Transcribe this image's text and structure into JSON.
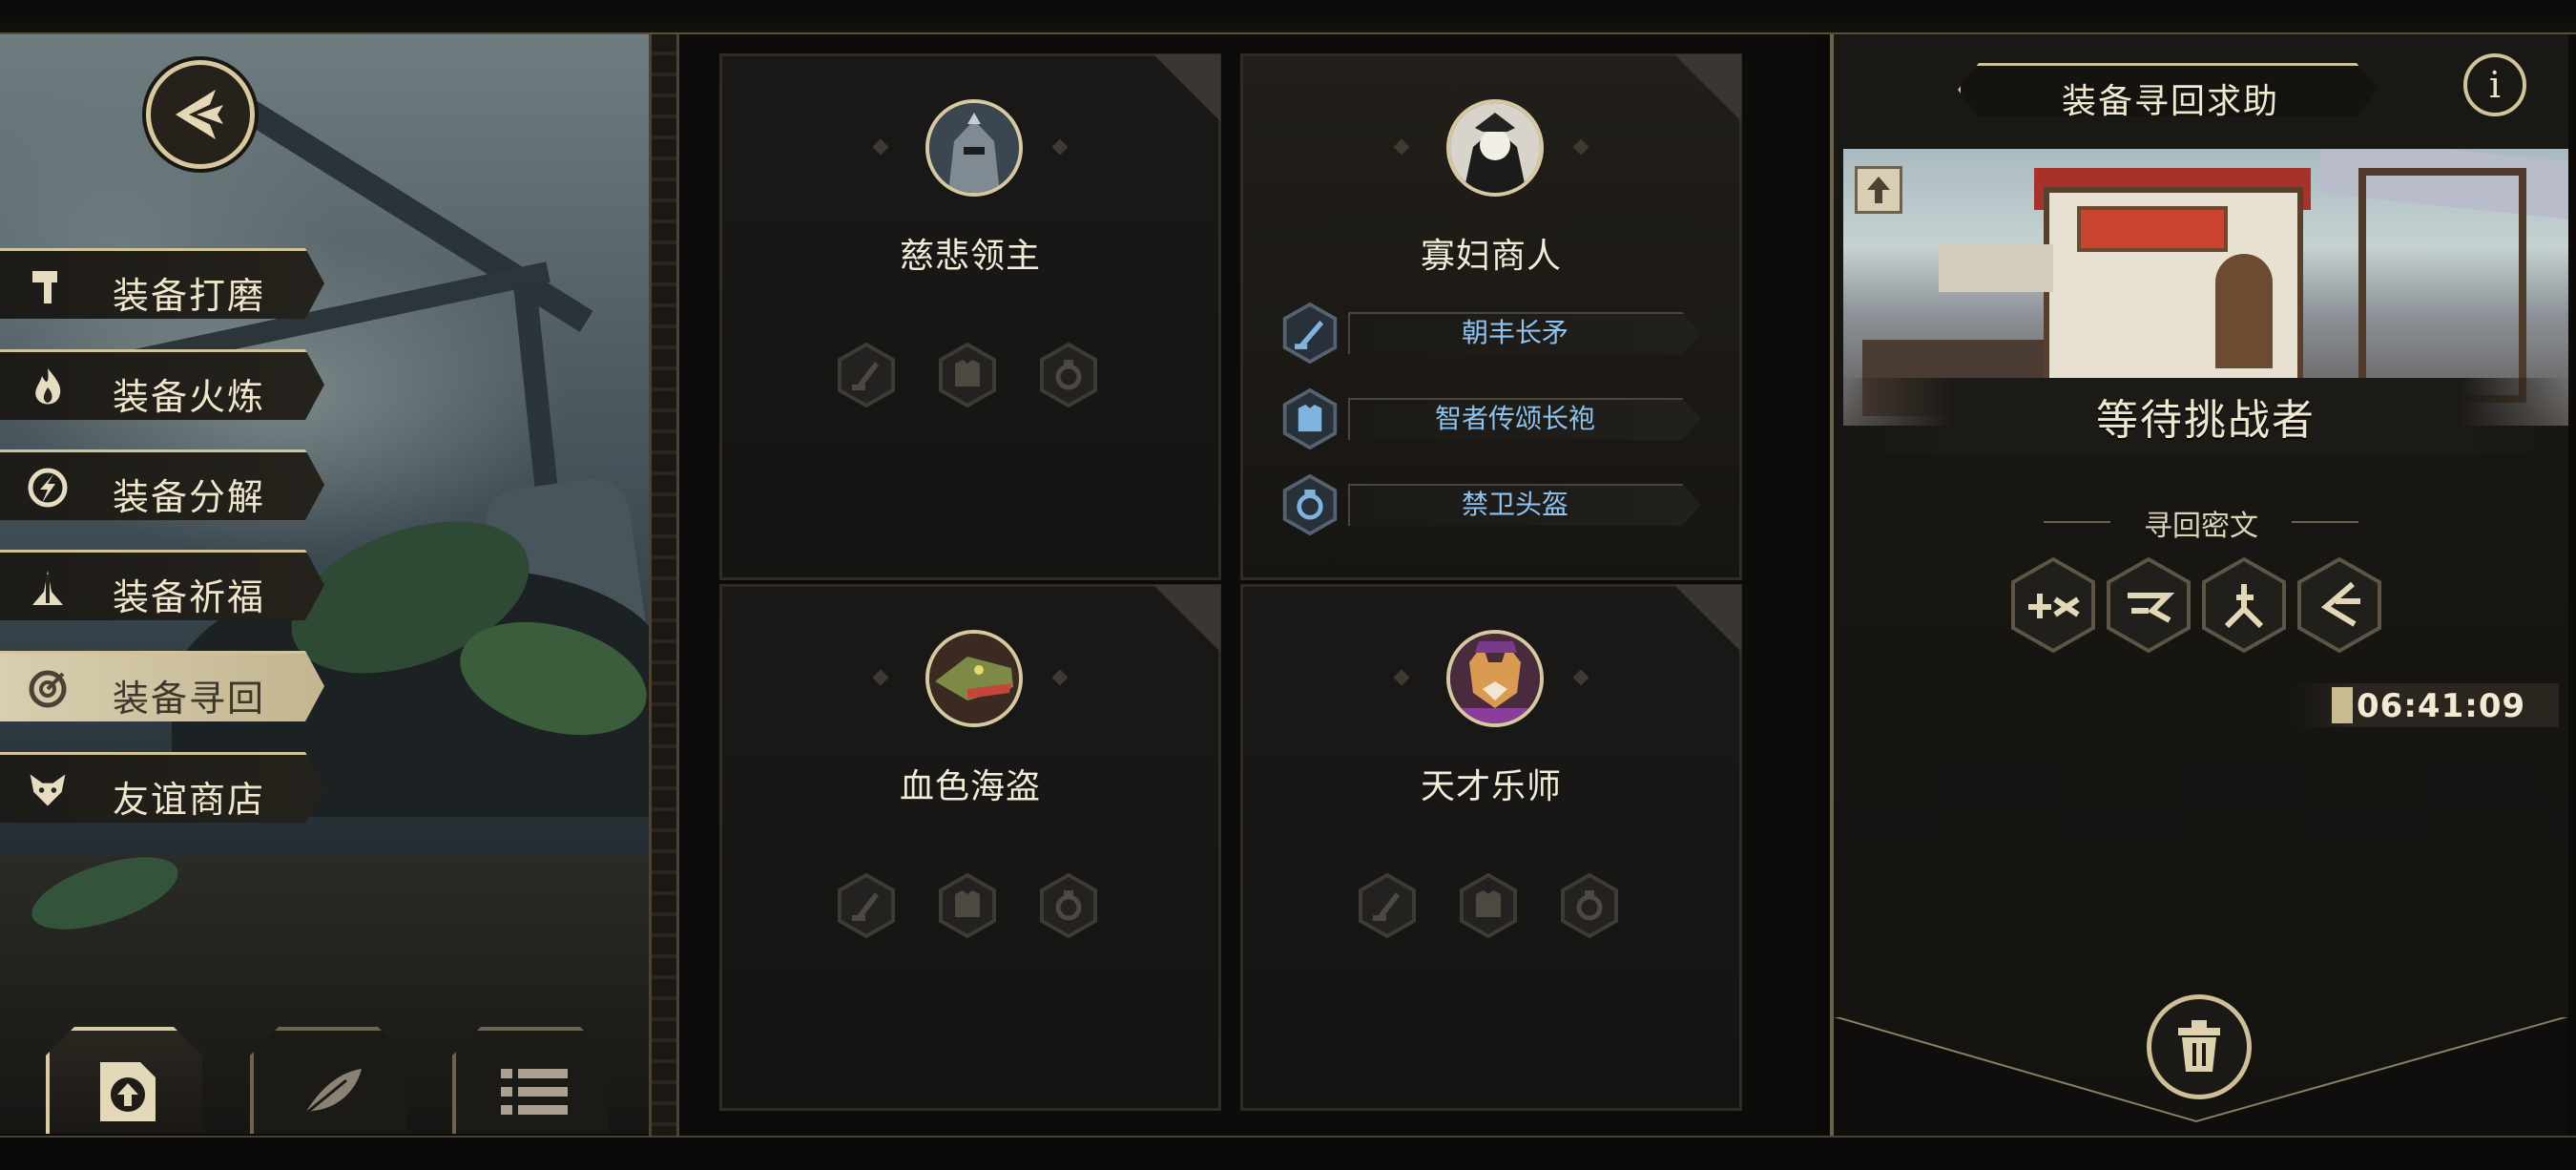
{
  "left_menu": {
    "items": [
      {
        "label": "装备打磨",
        "icon": "hammer-icon"
      },
      {
        "label": "装备火炼",
        "icon": "flame-icon"
      },
      {
        "label": "装备分解",
        "icon": "disassemble-icon"
      },
      {
        "label": "装备祈福",
        "icon": "praying-hands-icon"
      },
      {
        "label": "装备寻回",
        "icon": "target-icon",
        "active": true
      },
      {
        "label": "友谊商店",
        "icon": "fox-icon"
      }
    ],
    "bottom_buttons": [
      "upload-icon",
      "feather-icon",
      "list-icon"
    ]
  },
  "cards": [
    {
      "name": "慈悲领主",
      "avatar": "knight-avatar",
      "rewards": []
    },
    {
      "name": "寡妇商人",
      "avatar": "merchant-avatar",
      "selected": true,
      "rewards": [
        "朝丰长矛",
        "智者传颂长袍",
        "禁卫头盔"
      ]
    },
    {
      "name": "血色海盗",
      "avatar": "pirate-lizard-avatar",
      "rewards": []
    },
    {
      "name": "天才乐师",
      "avatar": "fox-musician-avatar",
      "rewards": []
    }
  ],
  "right_panel": {
    "title": "装备寻回求助",
    "info": "i",
    "status": "等待挑战者",
    "cipher_title": "寻回密文",
    "timer": "06:41:09"
  },
  "colors": {
    "accent": "#d2c49a",
    "reward_text": "#8fc3ef",
    "background": "#0b0a09"
  }
}
